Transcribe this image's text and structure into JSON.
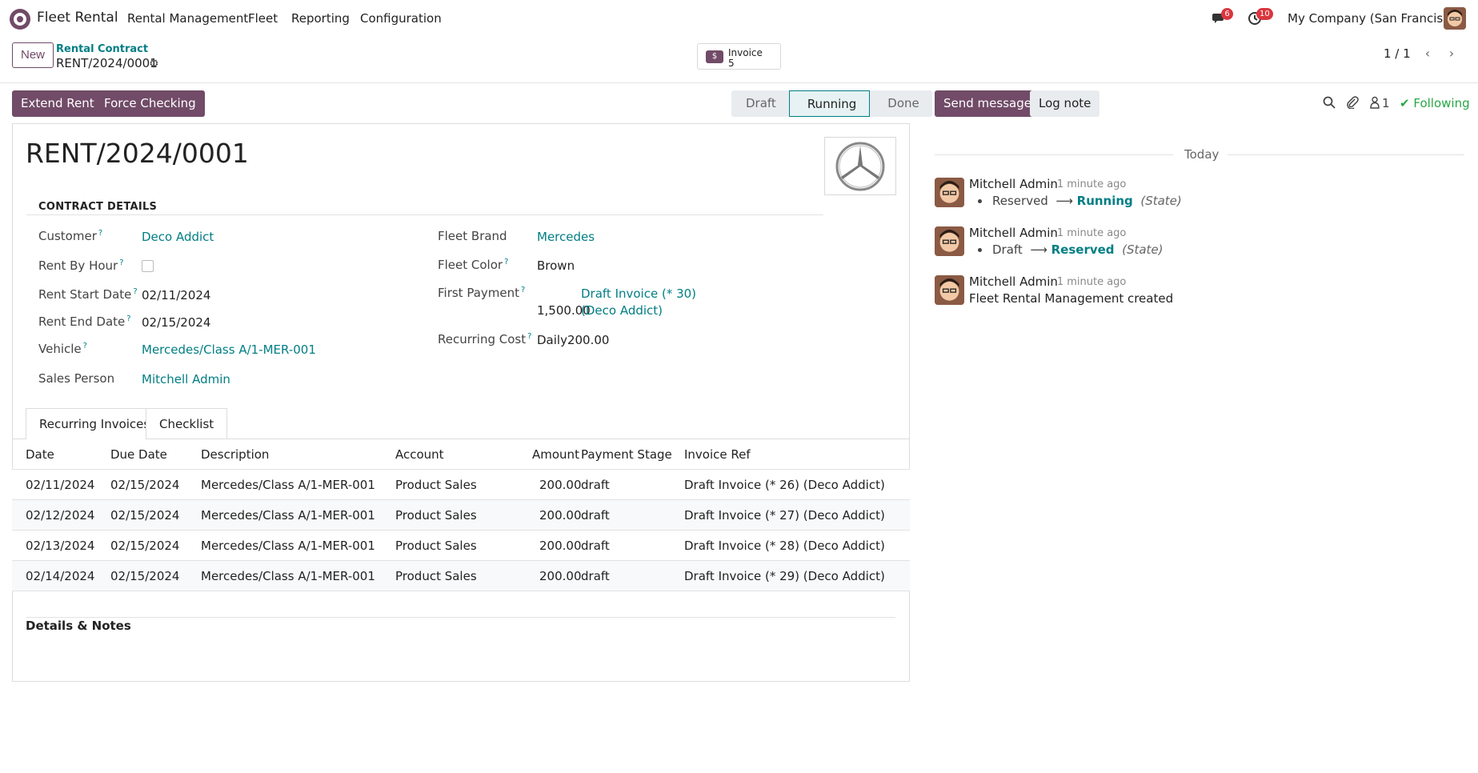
{
  "app": {
    "name": "Fleet Rental",
    "menu": [
      "Rental Management",
      "Fleet",
      "Reporting",
      "Configuration"
    ],
    "messages_badge": "6",
    "activities_badge": "10",
    "company": "My Company (San Francisco)"
  },
  "control": {
    "new_label": "New",
    "breadcrumb_parent": "Rental Contract",
    "breadcrumb_current": "RENT/2024/0001",
    "smart_button_label": "Invoice",
    "smart_button_count": "5",
    "pager": "1 / 1"
  },
  "actions": {
    "extend_rent": "Extend Rent",
    "force_checking": "Force Checking"
  },
  "status": {
    "stages": [
      "Draft",
      "Running",
      "Done"
    ],
    "active": "Running"
  },
  "record": {
    "title": "RENT/2024/0001",
    "group_title": "CONTRACT DETAILS",
    "customer_label": "Customer",
    "customer": "Deco Addict",
    "rent_by_hour_label": "Rent By Hour",
    "rent_start_label": "Rent Start Date",
    "rent_start": "02/11/2024",
    "rent_end_label": "Rent End Date",
    "rent_end": "02/15/2024",
    "vehicle_label": "Vehicle",
    "vehicle": "Mercedes/Class A/1-MER-001",
    "sales_person_label": "Sales Person",
    "sales_person": "Mitchell Admin",
    "fleet_brand_label": "Fleet Brand",
    "fleet_brand": "Mercedes",
    "fleet_color_label": "Fleet Color",
    "fleet_color": "Brown",
    "first_payment_label": "First Payment",
    "first_payment_invoice": "Draft Invoice (* 30)",
    "first_payment_amount": "1,500.00",
    "first_payment_partner": "(Deco Addict)",
    "recurring_cost_label": "Recurring Cost",
    "recurring_cost": "Daily200.00"
  },
  "tabs": [
    "Recurring Invoices",
    "Checklist"
  ],
  "table": {
    "headers": [
      "Date",
      "Due Date",
      "Description",
      "Account",
      "Amount",
      "Payment Stage",
      "Invoice Ref"
    ],
    "rows": [
      [
        "02/11/2024",
        "02/15/2024",
        "Mercedes/Class A/1-MER-001",
        "Product Sales",
        "200.00",
        "draft",
        "Draft Invoice (* 26) (Deco Addict)"
      ],
      [
        "02/12/2024",
        "02/15/2024",
        "Mercedes/Class A/1-MER-001",
        "Product Sales",
        "200.00",
        "draft",
        "Draft Invoice (* 27) (Deco Addict)"
      ],
      [
        "02/13/2024",
        "02/15/2024",
        "Mercedes/Class A/1-MER-001",
        "Product Sales",
        "200.00",
        "draft",
        "Draft Invoice (* 28) (Deco Addict)"
      ],
      [
        "02/14/2024",
        "02/15/2024",
        "Mercedes/Class A/1-MER-001",
        "Product Sales",
        "200.00",
        "draft",
        "Draft Invoice (* 29) (Deco Addict)"
      ]
    ]
  },
  "notes_title": "Details & Notes",
  "chatter": {
    "send_message": "Send message",
    "log_note": "Log note",
    "follower_count": "1",
    "following": "Following",
    "today": "Today",
    "messages": [
      {
        "author": "Mitchell Admin",
        "time": "- 1 minute ago",
        "old": "Reserved",
        "new": "Running",
        "field": "(State)"
      },
      {
        "author": "Mitchell Admin",
        "time": "- 1 minute ago",
        "old": "Draft",
        "new": "Reserved",
        "field": "(State)"
      },
      {
        "author": "Mitchell Admin",
        "time": "- 1 minute ago",
        "body": "Fleet Rental Management created"
      }
    ]
  },
  "colors": {
    "primary": "#714b67",
    "link": "#017e84",
    "success": "#28a745",
    "badge": "#d9363e"
  }
}
